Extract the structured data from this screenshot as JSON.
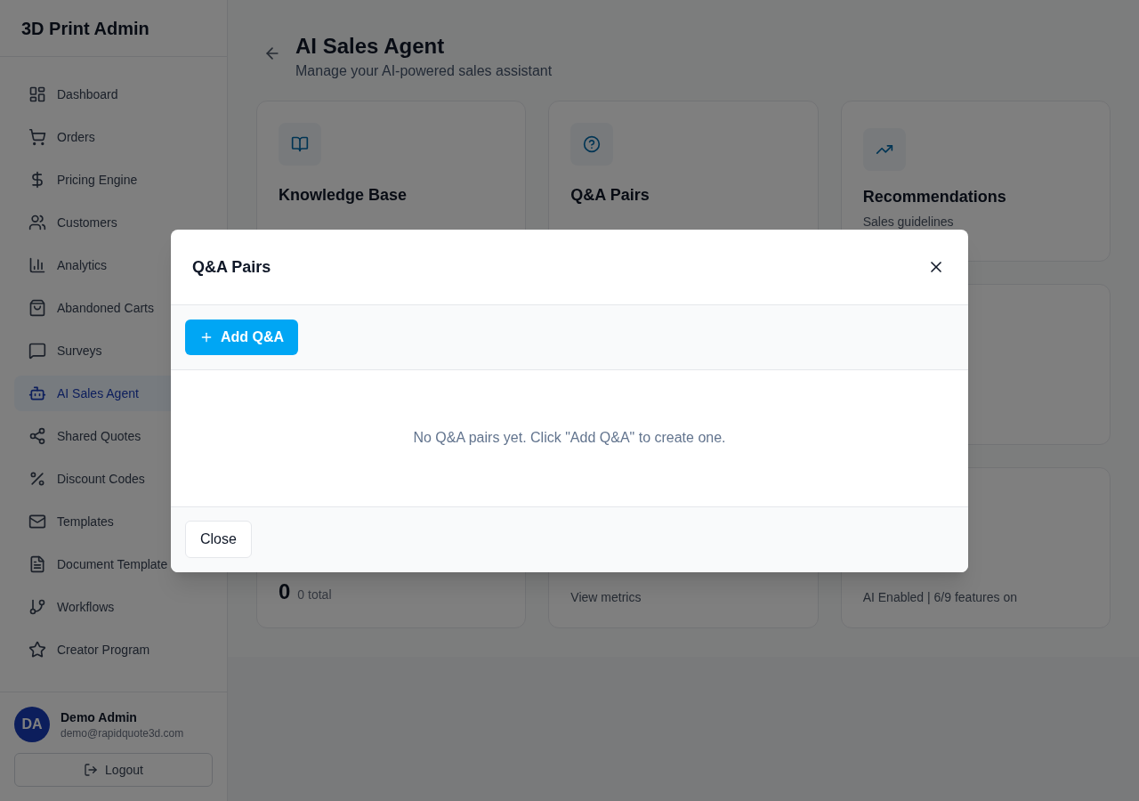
{
  "sidebar": {
    "brand": "3D Print Admin",
    "items": [
      {
        "label": "Dashboard",
        "selected": false
      },
      {
        "label": "Orders",
        "selected": false
      },
      {
        "label": "Pricing Engine",
        "selected": false
      },
      {
        "label": "Customers",
        "selected": false
      },
      {
        "label": "Analytics",
        "selected": false
      },
      {
        "label": "Abandoned Carts",
        "selected": false
      },
      {
        "label": "Surveys",
        "selected": false
      },
      {
        "label": "AI Sales Agent",
        "selected": true
      },
      {
        "label": "Shared Quotes",
        "selected": false
      },
      {
        "label": "Discount Codes",
        "selected": false
      },
      {
        "label": "Templates",
        "selected": false
      },
      {
        "label": "Document Template",
        "selected": false
      },
      {
        "label": "Workflows",
        "selected": false
      },
      {
        "label": "Creator Program",
        "selected": false
      }
    ],
    "user": {
      "initials": "DA",
      "name": "Demo Admin",
      "email": "demo@rapidquote3d.com"
    },
    "logout": "Logout"
  },
  "header": {
    "title": "AI Sales Agent",
    "subtitle": "Manage your AI-powered sales assistant"
  },
  "cards": [
    {
      "kind": "title",
      "title": "Knowledge Base"
    },
    {
      "kind": "title",
      "title": "Q&A Pairs"
    },
    {
      "kind": "text",
      "title": "Recommendations",
      "caption": "Sales guidelines"
    },
    {
      "kind": "blank"
    },
    {
      "kind": "blank"
    },
    {
      "kind": "blank"
    },
    {
      "kind": "stat",
      "value": "0",
      "caption": "0 total"
    },
    {
      "kind": "text",
      "caption": "View metrics"
    },
    {
      "kind": "text",
      "caption": "AI Enabled | 6/9 features on"
    }
  ],
  "modal": {
    "title": "Q&A Pairs",
    "add_button": "Add Q&A",
    "empty_message": "No Q&A pairs yet. Click \"Add Q&A\" to create one.",
    "close_button": "Close"
  }
}
